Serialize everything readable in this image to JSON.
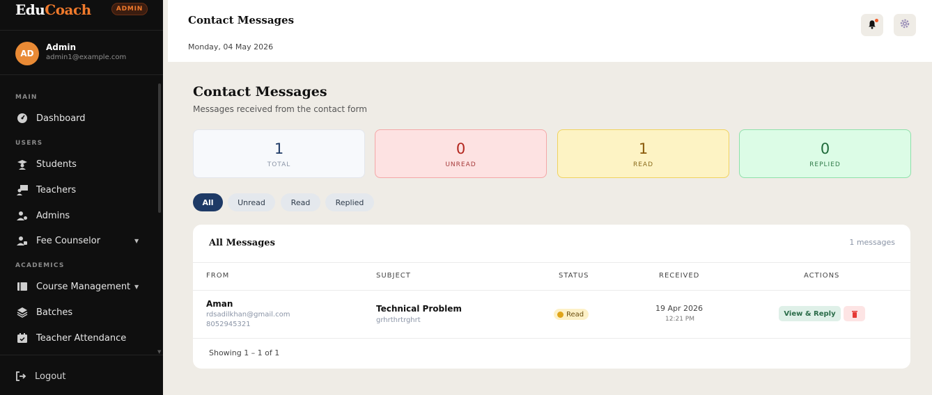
{
  "sidebar": {
    "brand": {
      "part1": "Edu",
      "part2": "Coach"
    },
    "role_badge": "ADMIN",
    "user": {
      "initials": "AD",
      "name": "Admin",
      "email": "admin1@example.com"
    },
    "sections": {
      "main": "MAIN",
      "users": "USERS",
      "academics": "ACADEMICS"
    },
    "items": [
      {
        "label": "Dashboard",
        "icon": "dashboard-icon"
      },
      {
        "label": "Students",
        "icon": "student-icon"
      },
      {
        "label": "Teachers",
        "icon": "teacher-icon"
      },
      {
        "label": "Admins",
        "icon": "admin-user-icon"
      },
      {
        "label": "Fee Counselor",
        "icon": "counselor-icon",
        "has_submenu": true
      },
      {
        "label": "Course Management",
        "icon": "book-icon",
        "has_submenu": true
      },
      {
        "label": "Batches",
        "icon": "layers-icon"
      },
      {
        "label": "Teacher Attendance",
        "icon": "calendar-check-icon"
      }
    ],
    "logout": "Logout"
  },
  "header": {
    "title": "Contact Messages",
    "date": "Monday, 04 May 2026"
  },
  "main": {
    "title": "Contact Messages",
    "subtitle": "Messages received from the contact form",
    "stats": [
      {
        "value": "1",
        "label": "TOTAL"
      },
      {
        "value": "0",
        "label": "UNREAD"
      },
      {
        "value": "1",
        "label": "READ"
      },
      {
        "value": "0",
        "label": "REPLIED"
      }
    ],
    "filters": [
      "All",
      "Unread",
      "Read",
      "Replied"
    ],
    "active_filter": "All",
    "table": {
      "title": "All Messages",
      "count": "1 messages",
      "columns": [
        "FROM",
        "SUBJECT",
        "STATUS",
        "RECEIVED",
        "ACTIONS"
      ],
      "rows": [
        {
          "name": "Aman",
          "email": "rdsadilkhan@gmail.com",
          "phone": "8052945321",
          "subject": "Technical Problem",
          "preview": "grhrthrtrghrt",
          "status": "Read",
          "date": "19 Apr 2026",
          "time": "12:21 PM",
          "action_view": "View & Reply"
        }
      ],
      "footer": "Showing 1 – 1 of 1"
    }
  },
  "colors": {
    "brand_accent": "#f07a2c",
    "primary_navy": "#1e3a66",
    "sidebar_bg": "#0f0f0f"
  }
}
